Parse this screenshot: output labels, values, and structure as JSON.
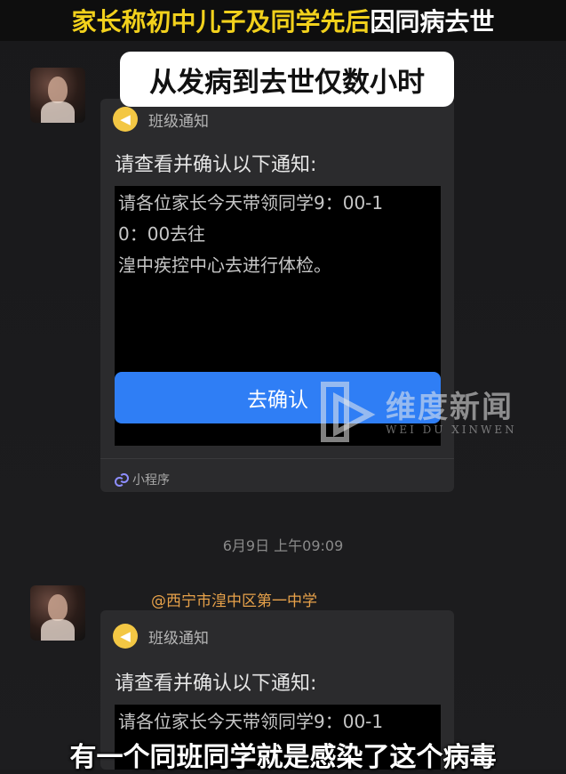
{
  "headline": {
    "part1": "家长称初中儿子及同学先后",
    "part2": "因同病去世"
  },
  "subheadline": "从发病到去世仅数小时",
  "messages": [
    {
      "sender": "",
      "card": {
        "source_label": "班级通知",
        "icon": "megaphone-icon",
        "title": "请查看并确认以下通知:",
        "preview_lines": [
          "请各位家长今天带领同学9：00-1",
          "0：00去往",
          "湟中疾控中心去进行体检。"
        ],
        "button_label": "去确认",
        "footer_label": "小程序"
      }
    },
    {
      "sender": "@西宁市湟中区第一中学",
      "card": {
        "source_label": "班级通知",
        "icon": "megaphone-icon",
        "title": "请查看并确认以下通知:",
        "preview_lines": [
          "请各位家长今天带领同学9：00-1"
        ]
      }
    }
  ],
  "timestamp": "6月9日 上午09:09",
  "watermark": {
    "cn": "维度新闻",
    "en": "WEI DU XINWEN"
  },
  "caption": "有一个同班同学就是感染了这个病毒",
  "colors": {
    "headline_yellow": "#f2d11c",
    "button_blue": "#2f7ef5",
    "card_bg": "#2b2b2d",
    "sender_orange": "#e8a24a"
  }
}
